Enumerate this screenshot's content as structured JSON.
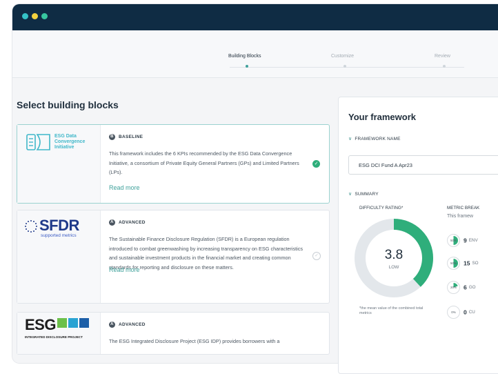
{
  "window": {
    "traffic_lights": {
      "colors": [
        "#34c3c7",
        "#f3d23f",
        "#37c7a0"
      ]
    },
    "titlebar_color": "#0f2c44"
  },
  "stepper": {
    "steps": [
      {
        "label": "Building Blocks",
        "state": "active"
      },
      {
        "label": "Customize",
        "state": "inactive"
      },
      {
        "label": "Review",
        "state": "inactive"
      }
    ],
    "active_color": "#3fa19b"
  },
  "main": {
    "heading": "Select building blocks",
    "cards": [
      {
        "logo_text": "ESG Data Convergence Initiative",
        "logo_lines": [
          "ESG Data",
          "Convergence",
          "Initiative"
        ],
        "logo_icon": "edci-logo-icon",
        "tag_letter": "B",
        "tag": "BASELINE",
        "description": "This framework includes the 6 KPIs recommended by the ESG Data Convergence Initiative, a consortium of Private Equity General Partners (GPs) and Limited Partners (LPs).",
        "read_more": "Read more",
        "selected": true
      },
      {
        "logo_text": "SFDR",
        "logo_sub": "supported metrics",
        "logo_icon": "eu-stars-icon",
        "tag_letter": "A",
        "tag": "ADVANCED",
        "description": "The Sustainable Finance Disclosure Regulation (SFDR) is a European regulation introduced to combat greenwashing by increasing transparency on ESG characteristics and sustainable investment products in the financial market and creating common standards for reporting and disclosure on these matters.",
        "read_more": "Read more",
        "selected": false
      },
      {
        "logo_text": "ESG",
        "logo_sub": "INTEGRATED DISCLOSURE PROJECT",
        "logo_icon": "esg-idp-icons",
        "tag_letter": "A",
        "tag": "ADVANCED",
        "description": "The ESG Integrated Disclosure Project (ESG IDP) provides borrowers with a",
        "read_more": "",
        "selected": false
      }
    ]
  },
  "panel": {
    "title": "Your framework",
    "framework_name_section": "FRAMEWORK NAME",
    "framework_name_value": "ESG DCI Fund A Apr23",
    "summary_section": "SUMMARY",
    "difficulty_label": "DIFFICULTY RATING*",
    "difficulty_value": "3.8",
    "difficulty_level": "LOW",
    "difficulty_fraction": 0.38,
    "footnote": "*the mean value of the combined total metrics",
    "breakdown_label": "METRIC BREAK",
    "breakdown_sub": "This framew",
    "metrics": [
      {
        "pct_label": "50%",
        "pct": 50,
        "count": "9",
        "label": "ENV"
      },
      {
        "pct_label": "50%",
        "pct": 50,
        "count": "15",
        "label": "SO"
      },
      {
        "pct_label": "20%",
        "pct": 20,
        "count": "6",
        "label": "GO"
      },
      {
        "pct_label": "0%",
        "pct": 0,
        "count": "0",
        "label": "CU"
      }
    ],
    "accent": "#2fae7b"
  }
}
